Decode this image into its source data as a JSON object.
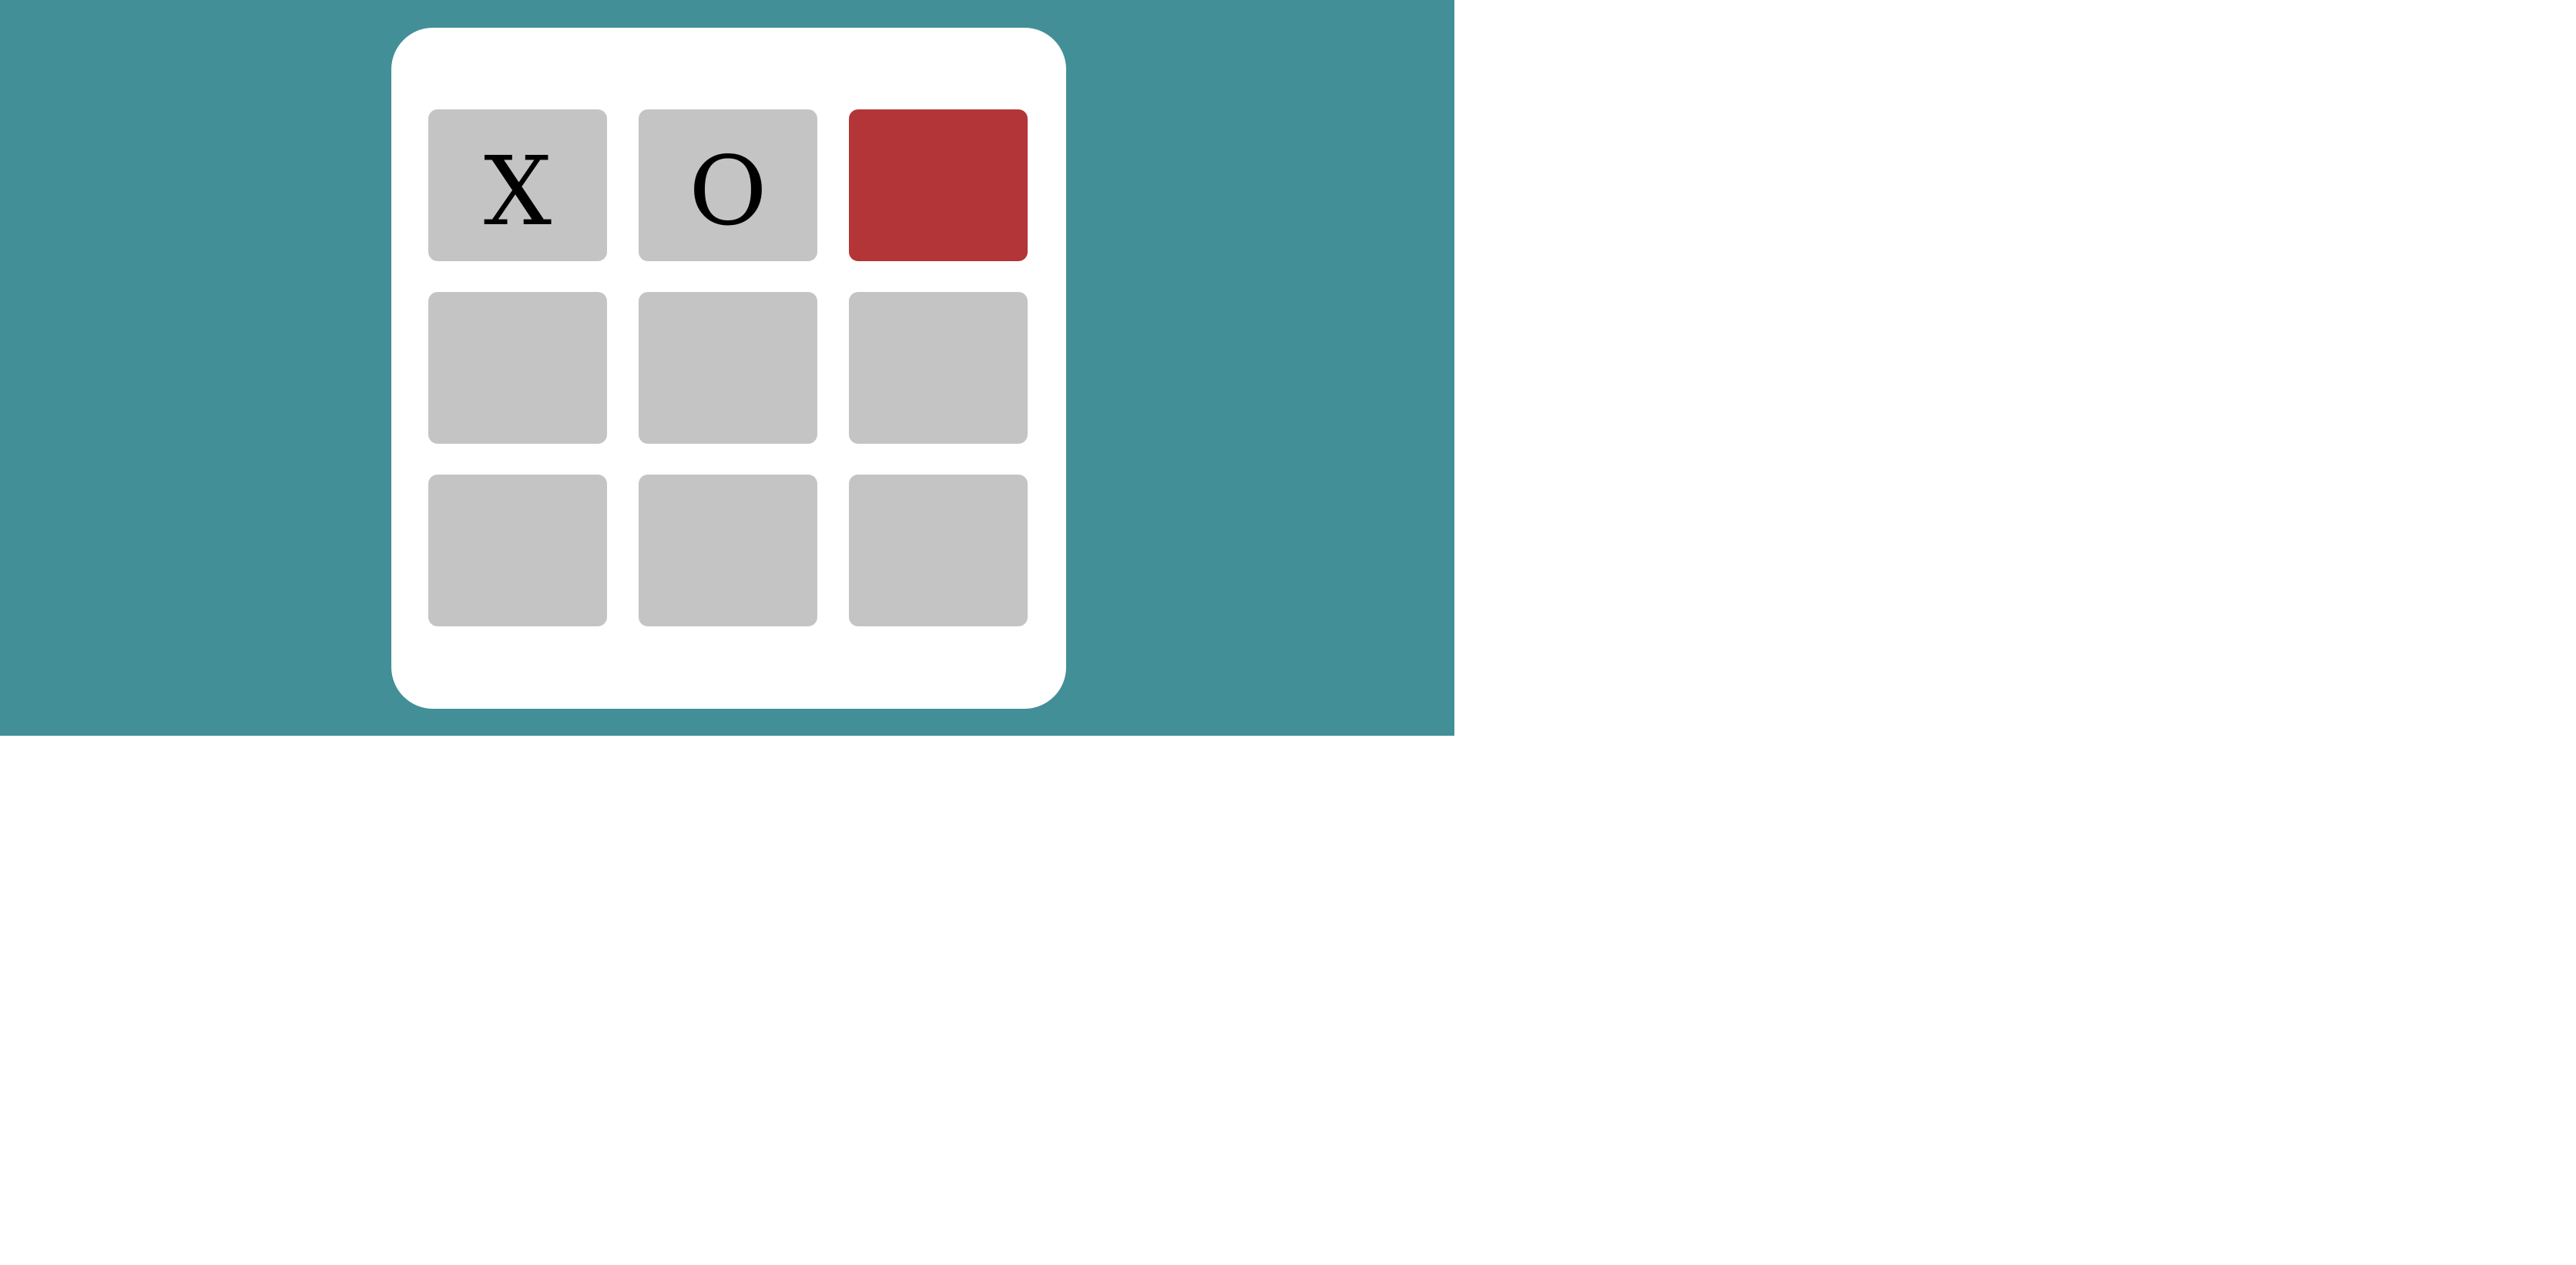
{
  "colors": {
    "background": "#428f97",
    "card": "#ffffff",
    "cell": "#c4c4c4",
    "highlight": "#b43537",
    "mark": "#000000"
  },
  "board": {
    "cells": [
      {
        "mark": "X",
        "highlighted": false
      },
      {
        "mark": "O",
        "highlighted": false
      },
      {
        "mark": "",
        "highlighted": true
      },
      {
        "mark": "",
        "highlighted": false
      },
      {
        "mark": "",
        "highlighted": false
      },
      {
        "mark": "",
        "highlighted": false
      },
      {
        "mark": "",
        "highlighted": false
      },
      {
        "mark": "",
        "highlighted": false
      },
      {
        "mark": "",
        "highlighted": false
      }
    ]
  }
}
